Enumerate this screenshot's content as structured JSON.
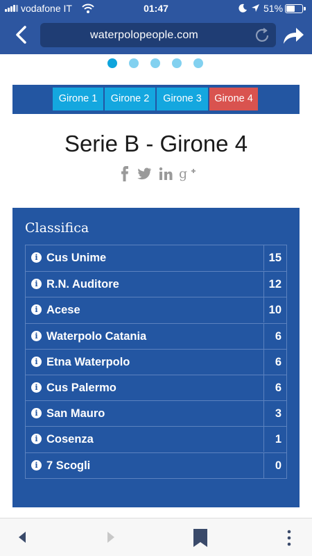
{
  "status_bar": {
    "carrier": "vodafone IT",
    "time": "01:47",
    "battery_pct": "51%",
    "battery_level": 0.51,
    "icons": [
      "signal-icon",
      "wifi-icon",
      "moon-icon",
      "location-icon",
      "battery-icon"
    ]
  },
  "browser": {
    "url": "waterpolopeople.com",
    "icons": [
      "back-icon",
      "reload-icon",
      "share-icon"
    ]
  },
  "carousel": {
    "count": 5,
    "active_index": 0
  },
  "tabs": [
    {
      "label": "Girone 1",
      "active": false
    },
    {
      "label": "Girone 2",
      "active": false
    },
    {
      "label": "Girone 3",
      "active": false
    },
    {
      "label": "Girone 4",
      "active": true
    }
  ],
  "page_title": "Serie B - Girone 4",
  "social_icons": [
    "facebook-icon",
    "twitter-icon",
    "linkedin-icon",
    "google-plus-icon"
  ],
  "standings": {
    "title": "Classifica",
    "rows": [
      {
        "team": "Cus Unime",
        "points": "15"
      },
      {
        "team": "R.N. Auditore",
        "points": "12"
      },
      {
        "team": "Acese",
        "points": "10"
      },
      {
        "team": "Waterpolo Catania",
        "points": "6"
      },
      {
        "team": "Etna Waterpolo",
        "points": "6"
      },
      {
        "team": "Cus Palermo",
        "points": "6"
      },
      {
        "team": "San Mauro",
        "points": "3"
      },
      {
        "team": "Cosenza",
        "points": "1"
      },
      {
        "team": "7 Scogli",
        "points": "0"
      }
    ]
  },
  "bottom_bar": {
    "icons": [
      "back-arrow-icon",
      "forward-arrow-icon",
      "bookmark-icon",
      "more-icon"
    ]
  },
  "colors": {
    "chrome": "#2d56a0",
    "panel": "#2356a2",
    "tab": "#14a7df",
    "tab_active": "#d9534f",
    "dot": "#82d1f0",
    "dot_active": "#0ea4dc"
  }
}
